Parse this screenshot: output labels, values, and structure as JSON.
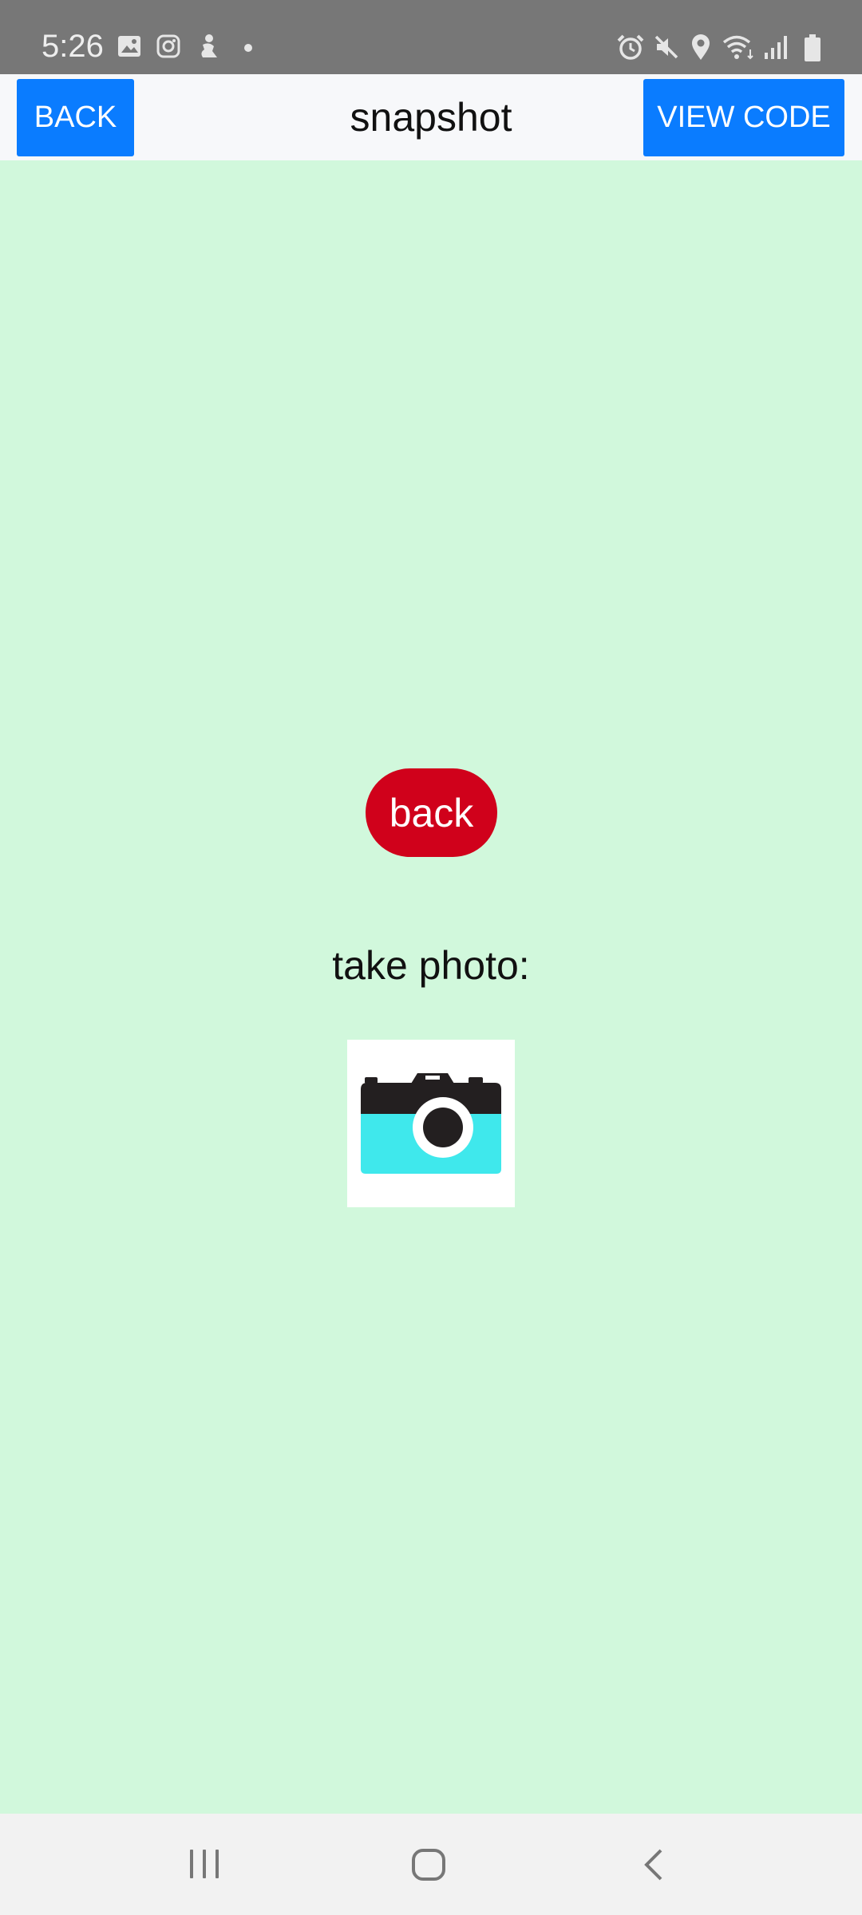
{
  "status_bar": {
    "time": "5:26",
    "left_icons": [
      "image-icon",
      "instagram-icon",
      "figure-icon",
      "dot-icon"
    ],
    "right_icons": [
      "alarm-icon",
      "mute-icon",
      "location-icon",
      "wifi-icon",
      "signal-icon",
      "battery-icon"
    ]
  },
  "header": {
    "back_label": "BACK",
    "title": "snapshot",
    "view_code_label": "VIEW CODE"
  },
  "main": {
    "back_button_label": "back",
    "take_photo_label": "take photo:",
    "camera_icon": "camera-icon"
  },
  "nav_bar": {
    "icons": [
      "recent-apps-icon",
      "home-icon",
      "back-nav-icon"
    ]
  },
  "colors": {
    "status_bar_bg": "#777777",
    "header_bg": "#f7f8fa",
    "header_button": "#0a7cff",
    "content_bg": "#d1f8dc",
    "back_pill": "#d0011b",
    "camera_accent": "#3fe8ec",
    "nav_bar_bg": "#f2f2f2"
  }
}
